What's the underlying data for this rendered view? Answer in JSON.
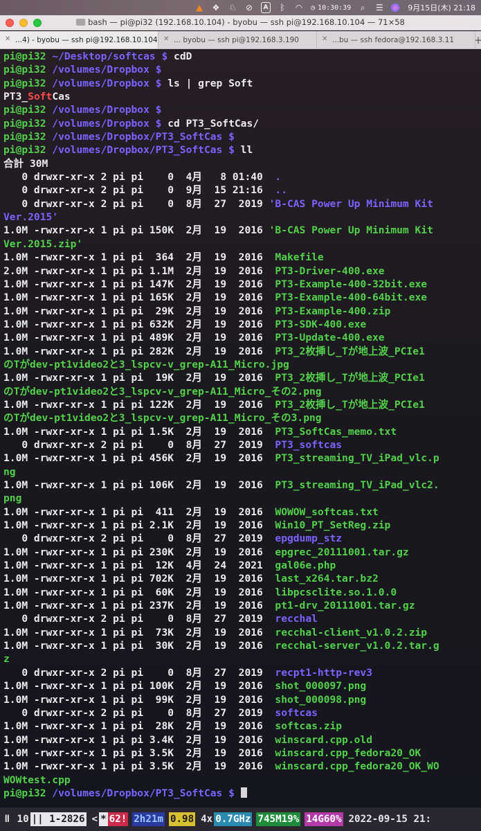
{
  "menubar": {
    "icons": [
      "vlc-cone-icon",
      "dropbox-icon",
      "evernote-icon",
      "muted-icon",
      "input-method-icon",
      "bluetooth-icon",
      "wifi-icon",
      "search-icon",
      "control-center-icon",
      "siri-icon"
    ],
    "input_label": "A",
    "clock": "10:30:39",
    "date": "9月15日(木) 21:18"
  },
  "window": {
    "title": "bash — pi@pi32 (192.168.10.104) - byobu — ssh pi@192.168.10.104 — 71×58"
  },
  "tabs": [
    {
      "label": "...4) - byobu — ssh pi@192.168.10.104",
      "active": true
    },
    {
      "label": "... byobu — ssh pi@192.168.3.190",
      "active": false
    },
    {
      "label": "...bu — ssh fedora@192.168.3.11",
      "active": false
    }
  ],
  "new_tab_label": "+",
  "terminal": {
    "lines": [
      [
        [
          "g",
          "pi@pi32 "
        ],
        [
          "p",
          "~/Desktop/softcas $ "
        ],
        [
          "w",
          "cdD"
        ]
      ],
      [
        [
          "g",
          "pi@pi32 "
        ],
        [
          "p",
          "/volumes/Dropbox $ "
        ]
      ],
      [
        [
          "g",
          "pi@pi32 "
        ],
        [
          "p",
          "/volumes/Dropbox $ "
        ],
        [
          "w",
          "ls | grep Soft"
        ]
      ],
      [
        [
          "w",
          "PT3_"
        ],
        [
          "r",
          "Soft"
        ],
        [
          "w",
          "Cas"
        ]
      ],
      [
        [
          "g",
          "pi@pi32 "
        ],
        [
          "p",
          "/volumes/Dropbox $ "
        ]
      ],
      [
        [
          "g",
          "pi@pi32 "
        ],
        [
          "p",
          "/volumes/Dropbox $ "
        ],
        [
          "w",
          "cd PT3_SoftCas/"
        ]
      ],
      [
        [
          "g",
          "pi@pi32 "
        ],
        [
          "p",
          "/volumes/Dropbox/PT3_SoftCas $ "
        ]
      ],
      [
        [
          "g",
          "pi@pi32 "
        ],
        [
          "p",
          "/volumes/Dropbox/PT3_SoftCas $ "
        ],
        [
          "w",
          "ll"
        ]
      ],
      [
        [
          "w",
          "合計 30M"
        ]
      ],
      [
        [
          "w",
          "   0 drwxr-xr-x 2 pi pi    0  4月   8 01:40  "
        ],
        [
          "p",
          "."
        ]
      ],
      [
        [
          "w",
          "   0 drwxr-xr-x 2 pi pi    0  9月  15 21:16  "
        ],
        [
          "p",
          ".."
        ]
      ],
      [
        [
          "w",
          "   0 drwxr-xr-x 2 pi pi    0  8月  27  2019 "
        ],
        [
          "p",
          "'B-CAS Power Up Minimum Kit"
        ]
      ],
      [
        [
          "p",
          "Ver.2015'"
        ]
      ],
      [
        [
          "w",
          "1.0M -rwxr-xr-x 1 pi pi 150K  2月  19  2016 "
        ],
        [
          "g",
          "'B-CAS Power Up Minimum Kit"
        ]
      ],
      [
        [
          "g",
          "Ver.2015.zip'"
        ]
      ],
      [
        [
          "w",
          "1.0M -rwxr-xr-x 1 pi pi  364  2月  19  2016  "
        ],
        [
          "g",
          "Makefile"
        ]
      ],
      [
        [
          "w",
          "2.0M -rwxr-xr-x 1 pi pi 1.1M  2月  19  2016  "
        ],
        [
          "g",
          "PT3-Driver-400.exe"
        ]
      ],
      [
        [
          "w",
          "1.0M -rwxr-xr-x 1 pi pi 147K  2月  19  2016  "
        ],
        [
          "g",
          "PT3-Example-400-32bit.exe"
        ]
      ],
      [
        [
          "w",
          "1.0M -rwxr-xr-x 1 pi pi 165K  2月  19  2016  "
        ],
        [
          "g",
          "PT3-Example-400-64bit.exe"
        ]
      ],
      [
        [
          "w",
          "1.0M -rwxr-xr-x 1 pi pi  29K  2月  19  2016  "
        ],
        [
          "g",
          "PT3-Example-400.zip"
        ]
      ],
      [
        [
          "w",
          "1.0M -rwxr-xr-x 1 pi pi 632K  2月  19  2016  "
        ],
        [
          "g",
          "PT3-SDK-400.exe"
        ]
      ],
      [
        [
          "w",
          "1.0M -rwxr-xr-x 1 pi pi 489K  2月  19  2016  "
        ],
        [
          "g",
          "PT3-Update-400.exe"
        ]
      ],
      [
        [
          "w",
          "1.0M -rwxr-xr-x 1 pi pi 282K  2月  19  2016  "
        ],
        [
          "g",
          "PT3_2枚挿し_Tが地上波_PCIe1"
        ]
      ],
      [
        [
          "g",
          "のTがdev-pt1video2と3_lspcv-v_grep-A11_Micro.jpg"
        ]
      ],
      [
        [
          "w",
          "1.0M -rwxr-xr-x 1 pi pi  19K  2月  19  2016  "
        ],
        [
          "g",
          "PT3_2枚挿し_Tが地上波_PCIe1"
        ]
      ],
      [
        [
          "g",
          "のTがdev-pt1video2と3_lspcv-v_grep-A11_Micro_その2.png"
        ]
      ],
      [
        [
          "w",
          "1.0M -rwxr-xr-x 1 pi pi 122K  2月  19  2016  "
        ],
        [
          "g",
          "PT3_2枚挿し_Tが地上波_PCIe1"
        ]
      ],
      [
        [
          "g",
          "のTがdev-pt1video2と3_lspcv-v_grep-A11_Micro_その3.png"
        ]
      ],
      [
        [
          "w",
          "1.0M -rwxr-xr-x 1 pi pi 1.5K  2月  19  2016  "
        ],
        [
          "g",
          "PT3_SoftCas_memo.txt"
        ]
      ],
      [
        [
          "w",
          "   0 drwxr-xr-x 2 pi pi    0  8月  27  2019  "
        ],
        [
          "p",
          "PT3_softcas"
        ]
      ],
      [
        [
          "w",
          "1.0M -rwxr-xr-x 1 pi pi 456K  2月  19  2016  "
        ],
        [
          "g",
          "PT3_streaming_TV_iPad_vlc.p"
        ]
      ],
      [
        [
          "g",
          "ng"
        ]
      ],
      [
        [
          "w",
          "1.0M -rwxr-xr-x 1 pi pi 106K  2月  19  2016  "
        ],
        [
          "g",
          "PT3_streaming_TV_iPad_vlc2."
        ]
      ],
      [
        [
          "g",
          "png"
        ]
      ],
      [
        [
          "w",
          "1.0M -rwxr-xr-x 1 pi pi  411  2月  19  2016  "
        ],
        [
          "g",
          "WOWOW_softcas.txt"
        ]
      ],
      [
        [
          "w",
          "1.0M -rwxr-xr-x 1 pi pi 2.1K  2月  19  2016  "
        ],
        [
          "g",
          "Win10_PT_SetReg.zip"
        ]
      ],
      [
        [
          "w",
          "   0 drwxr-xr-x 2 pi pi    0  8月  27  2019  "
        ],
        [
          "p",
          "epgdump_stz"
        ]
      ],
      [
        [
          "w",
          "1.0M -rwxr-xr-x 1 pi pi 230K  2月  19  2016  "
        ],
        [
          "g",
          "epgrec_20111001.tar.gz"
        ]
      ],
      [
        [
          "w",
          "1.0M -rwxr-xr-x 1 pi pi  12K  4月  24  2021  "
        ],
        [
          "g",
          "gal06e.php"
        ]
      ],
      [
        [
          "w",
          "1.0M -rwxr-xr-x 1 pi pi 702K  2月  19  2016  "
        ],
        [
          "g",
          "last_x264.tar.bz2"
        ]
      ],
      [
        [
          "w",
          "1.0M -rwxr-xr-x 1 pi pi  60K  2月  19  2016  "
        ],
        [
          "g",
          "libpcsclite.so.1.0.0"
        ]
      ],
      [
        [
          "w",
          "1.0M -rwxr-xr-x 1 pi pi 237K  2月  19  2016  "
        ],
        [
          "g",
          "pt1-drv_20111001.tar.gz"
        ]
      ],
      [
        [
          "w",
          "   0 drwxr-xr-x 2 pi pi    0  8月  27  2019  "
        ],
        [
          "p",
          "recchal"
        ]
      ],
      [
        [
          "w",
          "1.0M -rwxr-xr-x 1 pi pi  73K  2月  19  2016  "
        ],
        [
          "g",
          "recchal-client_v1.0.2.zip"
        ]
      ],
      [
        [
          "w",
          "1.0M -rwxr-xr-x 1 pi pi  30K  2月  19  2016  "
        ],
        [
          "g",
          "recchal-server_v1.0.2.tar.g"
        ]
      ],
      [
        [
          "g",
          "z"
        ]
      ],
      [
        [
          "w",
          "   0 drwxr-xr-x 2 pi pi    0  8月  27  2019  "
        ],
        [
          "p",
          "recpt1-http-rev3"
        ]
      ],
      [
        [
          "w",
          "1.0M -rwxr-xr-x 1 pi pi 100K  2月  19  2016  "
        ],
        [
          "g",
          "shot_000097.png"
        ]
      ],
      [
        [
          "w",
          "1.0M -rwxr-xr-x 1 pi pi  99K  2月  19  2016  "
        ],
        [
          "g",
          "shot_000098.png"
        ]
      ],
      [
        [
          "w",
          "   0 drwxr-xr-x 2 pi pi    0  8月  27  2019  "
        ],
        [
          "p",
          "softcas"
        ]
      ],
      [
        [
          "w",
          "1.0M -rwxr-xr-x 1 pi pi  28K  2月  19  2016  "
        ],
        [
          "g",
          "softcas.zip"
        ]
      ],
      [
        [
          "w",
          "1.0M -rwxr-xr-x 1 pi pi 3.4K  2月  19  2016  "
        ],
        [
          "g",
          "winscard.cpp.old"
        ]
      ],
      [
        [
          "w",
          "1.0M -rwxr-xr-x 1 pi pi 3.5K  2月  19  2016  "
        ],
        [
          "g",
          "winscard.cpp_fedora20_OK"
        ]
      ],
      [
        [
          "w",
          "1.0M -rwxr-xr-x 1 pi pi 3.5K  2月  19  2016  "
        ],
        [
          "g",
          "winscard.cpp_fedora20_OK_WO"
        ]
      ],
      [
        [
          "g",
          "WOWtest.cpp"
        ]
      ],
      [
        [
          "g",
          "pi@pi32 "
        ],
        [
          "p",
          "/volumes/Dropbox/PT3_SoftCas $ "
        ],
        [
          "cursor",
          ""
        ]
      ]
    ]
  },
  "statusbar": {
    "segments": [
      {
        "text": "ǁ",
        "style": "plain"
      },
      {
        "text": " 10 ",
        "style": "plain",
        "gap": true
      },
      {
        "text": "|| 1-2826",
        "style": "winactive"
      },
      {
        "text": "<",
        "style": "plain",
        "gap": true
      },
      {
        "text": "*",
        "style": "winactive"
      },
      {
        "text": "62!",
        "style": "red"
      },
      {
        "text": "2h21m",
        "style": "blue",
        "gap": true
      },
      {
        "text": "0.98",
        "style": "yellow",
        "gap": true
      },
      {
        "text": "4x",
        "style": "plain",
        "gap": true
      },
      {
        "text": "0.7GHz",
        "style": "cyan"
      },
      {
        "text": "745M19%",
        "style": "green",
        "gap": true
      },
      {
        "text": "14G60%",
        "style": "magenta",
        "gap": true
      },
      {
        "text": "2022-09-15 21:",
        "style": "plain",
        "gap": true
      }
    ]
  }
}
